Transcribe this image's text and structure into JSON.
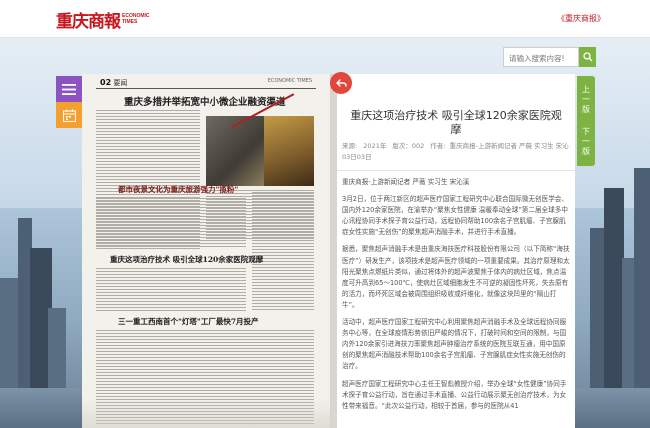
{
  "header": {
    "logo_cn": "重庆商報",
    "logo_en_1": "ECONOMIC",
    "logo_en_2": "TIMES",
    "edition_link": "《重庆商报》"
  },
  "search": {
    "placeholder": "请输入搜索内容!"
  },
  "tools": {
    "menu_icon": "menu-icon",
    "calendar_icon": "calendar-icon"
  },
  "newspaper": {
    "page_no": "02",
    "section": "要闻",
    "masthead_small": "ECONOMIC TIMES",
    "headline_1": "重庆多措并举拓宽中小微企业融资渠道",
    "headline_2": "都市夜景文化为重庆旅游强力\"揽粉\"",
    "headline_3": "重庆这项治疗技术 吸引全球120余家医院观摩",
    "headline_4": "三一重工西南首个\"灯塔\"工厂最快7月投产"
  },
  "article": {
    "title": "重庆这项治疗技术 吸引全球120余家医院观摩",
    "meta_source_label": "来源:",
    "meta_date": "2021年",
    "meta_edition": "版次：002",
    "meta_author_label": "作者:",
    "meta_author": "重庆商报-上游新闻记者 严薇 实习生 宋沁 03日03日",
    "byline": "重庆商报-上游新闻记者 严薇 实习生 宋沁溪",
    "paragraphs": [
      "3月2日，位于两江新区的超声医疗国家工程研究中心联合国际微无创医学会、国内外120余家医院，在渝举办“聚焦女性健康 温暖奉动全球”第二届全球多中心讯程协同手术探子育公益行动，远程协同帮助100余名子宫肌瘤、子宫腺肌症女性实施“无创伤”的聚焦超声消融手术，并进行手术直播。",
      "据悉，聚焦超声消融手术是由重庆海扶医疗科技股份有限公司（以下简称“海扶医疗”）研发生产，该项技术是超声医疗领域的一项重要成果。其治疗原理和太阳光聚焦点燃纸片类似，通过将体外的超声波聚焦于体内的病灶区域，焦点温度可升高到65～100℃，使病灶区域细胞发生不可逆的凝固性坏死，失去原有的活力，而坏死区域会被周围组织吸收或纤维化，就像这块凹里的“隔山打牛”。",
      "活动中，超声医疗国家工程研究中心利用聚焦超声消融手术及全球远程协同服务中心等，在全球疫情形势依旧严峻的情况下，打破时间和空间的限制，与国内外120余家引进海扶刀率聚焦超声肿瘤治疗系统的医院互联互通，用中国原创的聚焦超声消融技术帮助100余名子宫肌瘤、子宫腺肌症女性实施无创伤的治疗。",
      "超声医疗国家工程研究中心主任王智彪教授介绍，举办全球“女性健康”协同手术探子育公益行动，旨在通过手术直播、公益行动展示聚无创治疗技术，为女性带来福音。“此次公益行动，相较于首届，参与的医院从41"
    ]
  },
  "nav": {
    "prev_label": "上一版",
    "next_label": "下一版"
  },
  "colors": {
    "brand_red": "#c8161d",
    "green": "#7cb342",
    "purple": "#8c53c3",
    "orange": "#f3a02e",
    "back_red": "#e0463b"
  }
}
